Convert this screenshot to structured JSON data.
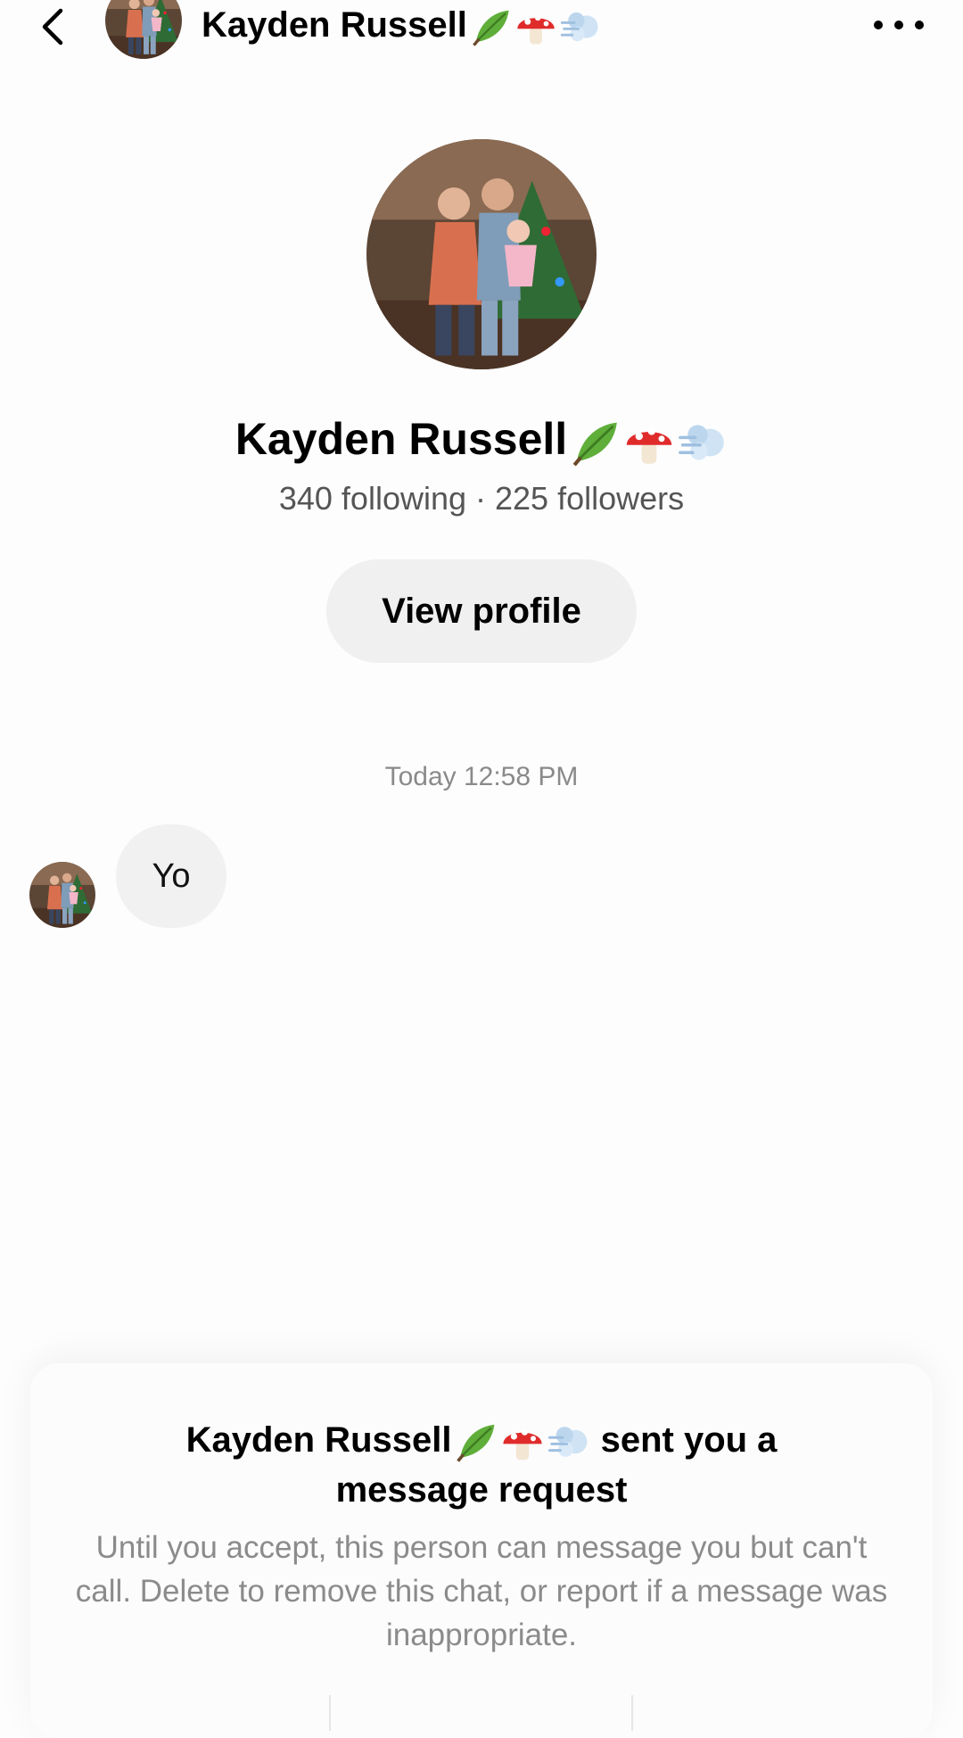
{
  "header": {
    "name": "Kayden Russell"
  },
  "profile": {
    "name": "Kayden Russell",
    "stats": "340 following · 225 followers",
    "view_profile_label": "View profile"
  },
  "conversation": {
    "timestamp": "Today 12:58 PM",
    "messages": [
      {
        "text": "Yo"
      }
    ]
  },
  "request": {
    "title_name": "Kayden Russell",
    "title_suffix": " sent you a",
    "title_line2": "message request",
    "description": "Until you accept, this person can message you but can't call. Delete to remove this chat, or report if a message was inappropriate."
  },
  "name_emojis": [
    "leaf-emoji",
    "mushroom-emoji",
    "dash-emoji"
  ]
}
